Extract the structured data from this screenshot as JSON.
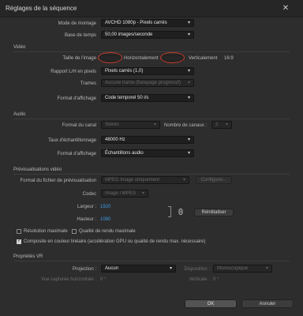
{
  "window": {
    "title": "Réglages de la séquence",
    "close_icon": "close-icon"
  },
  "sequence": {
    "editing_mode_label": "Mode de montage",
    "editing_mode_value": "AVCHD 1080p - Pixels carrés",
    "timebase_label": "Base de temps",
    "timebase_value": "50,00  images/seconde"
  },
  "video": {
    "title": "Vidéo",
    "frame_size_label": "Taille de l'image",
    "horizontal_label": "Horizontalement",
    "vertical_label": "Verticalement",
    "aspect": "16:9",
    "pixel_aspect_label": "Rapport L/H en pixels",
    "pixel_aspect_value": "Pixels carrés (1,0)",
    "fields_label": "Trames",
    "fields_value": "Aucune trame (Balayage progressif)",
    "display_format_label": "Format d'affichage",
    "display_format_value": "Code temporel 50 i/s"
  },
  "audio": {
    "title": "Audio",
    "channel_format_label": "Format du canal",
    "channel_format_value": "Stéréo",
    "channels_label": "Nombre de canaux :",
    "channels_value": "2",
    "sample_rate_label": "Taux d'échantillonnage",
    "sample_rate_value": "48000 Hz",
    "display_format_label": "Format d'affichage",
    "display_format_value": "Échantillons audio"
  },
  "preview": {
    "title": "Prévisualisations vidéo",
    "file_format_label": "Format du fichier de prévisualisation",
    "file_format_value": "MPEG Image uniquement",
    "configure_label": "Configurer...",
    "codec_label": "Codec",
    "codec_value": "Image I MPEG",
    "width_label": "Largeur :",
    "width_value": "1920",
    "height_label": "Hauteur :",
    "height_value": "1080",
    "reset_label": "Réinitialiser",
    "max_resolution_label": "Résolution maximale",
    "max_quality_label": "Qualité de rendu maximale",
    "linear_color_label": "Composite en couleur linéaire (accélération GPU ou qualité de rendu max. nécessaire)",
    "max_resolution_checked": false,
    "max_quality_checked": false,
    "linear_color_checked": true
  },
  "vr": {
    "title": "Propriétés VR",
    "projection_label": "Projection :",
    "projection_value": "Aucun",
    "layout_label": "Disposition :",
    "layout_value": "Monoscopique",
    "h_fov_label": "Vue capturée horizontale :",
    "h_fov_value": "0 °",
    "vertical_label": "Verticale :",
    "vertical_value": "0 °"
  },
  "footer": {
    "ok_label": "OK",
    "cancel_label": "Annuler"
  },
  "colors": {
    "accent_blue": "#3f98e0",
    "annotation_red": "#c0392b",
    "background": "#2d2d2d"
  }
}
